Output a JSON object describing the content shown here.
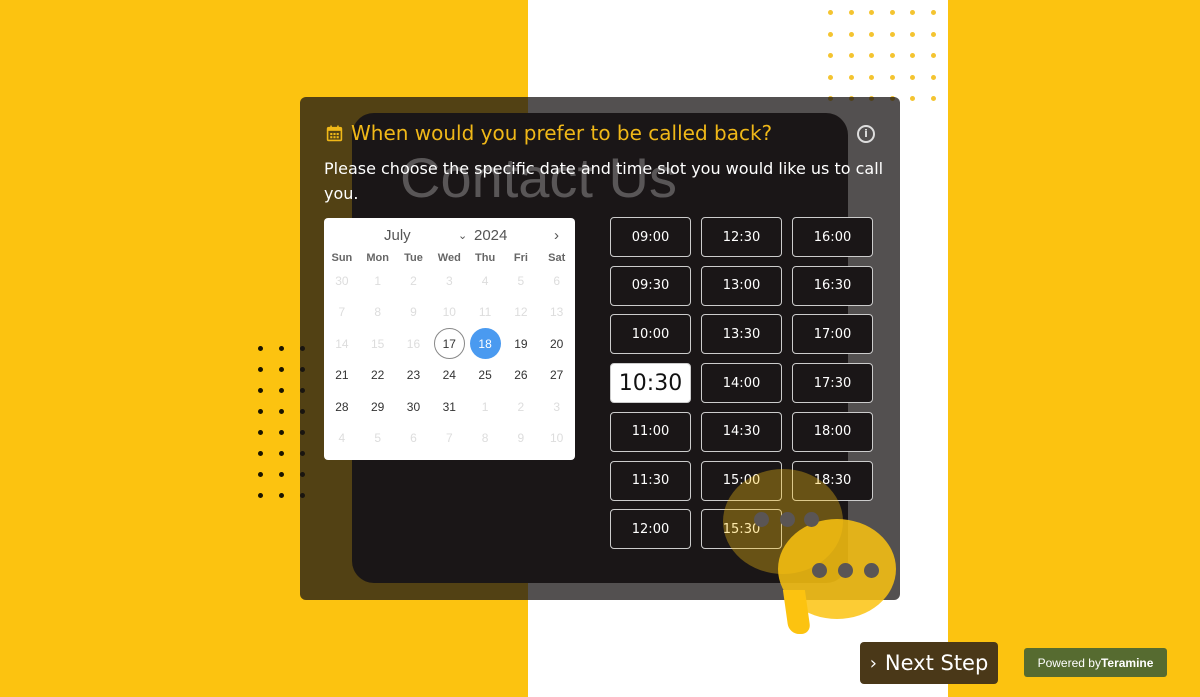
{
  "watermark": "Contact Us",
  "title": "When would you prefer to be called back?",
  "subtitle": "Please choose the specific date and time slot you would like us to call you.",
  "calendar": {
    "month": "July",
    "year": "2024",
    "weekdays": [
      "Sun",
      "Mon",
      "Tue",
      "Wed",
      "Thu",
      "Fri",
      "Sat"
    ],
    "days": [
      {
        "n": "30",
        "s": "dis"
      },
      {
        "n": "1",
        "s": "dis"
      },
      {
        "n": "2",
        "s": "dis"
      },
      {
        "n": "3",
        "s": "dis"
      },
      {
        "n": "4",
        "s": "dis"
      },
      {
        "n": "5",
        "s": "dis"
      },
      {
        "n": "6",
        "s": "dis"
      },
      {
        "n": "7",
        "s": "dis"
      },
      {
        "n": "8",
        "s": "dis"
      },
      {
        "n": "9",
        "s": "dis"
      },
      {
        "n": "10",
        "s": "dis"
      },
      {
        "n": "11",
        "s": "dis"
      },
      {
        "n": "12",
        "s": "dis"
      },
      {
        "n": "13",
        "s": "dis"
      },
      {
        "n": "14",
        "s": "dis"
      },
      {
        "n": "15",
        "s": "dis"
      },
      {
        "n": "16",
        "s": "dis"
      },
      {
        "n": "17",
        "s": "today"
      },
      {
        "n": "18",
        "s": "sel"
      },
      {
        "n": "19",
        "s": ""
      },
      {
        "n": "20",
        "s": ""
      },
      {
        "n": "21",
        "s": ""
      },
      {
        "n": "22",
        "s": ""
      },
      {
        "n": "23",
        "s": ""
      },
      {
        "n": "24",
        "s": ""
      },
      {
        "n": "25",
        "s": ""
      },
      {
        "n": "26",
        "s": ""
      },
      {
        "n": "27",
        "s": ""
      },
      {
        "n": "28",
        "s": ""
      },
      {
        "n": "29",
        "s": ""
      },
      {
        "n": "30",
        "s": ""
      },
      {
        "n": "31",
        "s": ""
      },
      {
        "n": "1",
        "s": "dis"
      },
      {
        "n": "2",
        "s": "dis"
      },
      {
        "n": "3",
        "s": "dis"
      },
      {
        "n": "4",
        "s": "dis"
      },
      {
        "n": "5",
        "s": "dis"
      },
      {
        "n": "6",
        "s": "dis"
      },
      {
        "n": "7",
        "s": "dis"
      },
      {
        "n": "8",
        "s": "dis"
      },
      {
        "n": "9",
        "s": "dis"
      },
      {
        "n": "10",
        "s": "dis"
      }
    ],
    "selected_color": "#4a9af0"
  },
  "time_slots": [
    [
      "09:00",
      "09:30",
      "10:00",
      "10:30",
      "11:00",
      "11:30",
      "12:00"
    ],
    [
      "12:30",
      "13:00",
      "13:30",
      "14:00",
      "14:30",
      "15:00",
      "15:30"
    ],
    [
      "16:00",
      "16:30",
      "17:00",
      "17:30",
      "18:00",
      "18:30"
    ]
  ],
  "selected_slot": "10:30",
  "next_label": "Next Step",
  "powered": {
    "prefix": "Powered by",
    "brand": "Teramine"
  },
  "colors": {
    "brand_yellow": "#fcc310",
    "title": "#f0b818"
  }
}
